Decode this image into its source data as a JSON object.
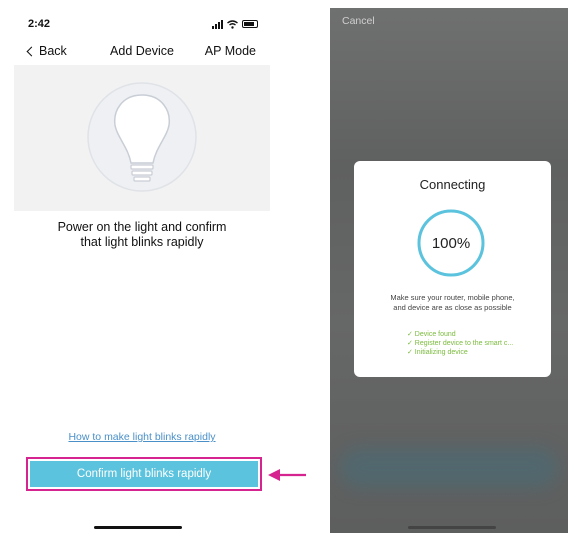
{
  "left_screen": {
    "status": {
      "time": "2:42"
    },
    "nav": {
      "back_label": "Back",
      "title": "Add Device",
      "mode_label": "AP Mode"
    },
    "instruction_line1": "Power on the light and confirm",
    "instruction_line2": "that light blinks  rapidly",
    "help_link": "How to make light blinks rapidly",
    "confirm_button": "Confirm light blinks rapidly",
    "highlight_color": "#d5238f",
    "button_color": "#5bc3dd"
  },
  "right_screen": {
    "cancel_label": "Cancel",
    "dialog": {
      "title": "Connecting",
      "progress_text": "100%",
      "progress_value": 1.0,
      "tip_line1": "Make sure your router, mobile phone,",
      "tip_line2": "and device are as close as possible",
      "steps": [
        "✓ Device found",
        "✓ Register device to the smart c...",
        "✓ Initializing device"
      ]
    },
    "ring_color": "#5bc3dd",
    "step_color": "#7bbb3d"
  }
}
